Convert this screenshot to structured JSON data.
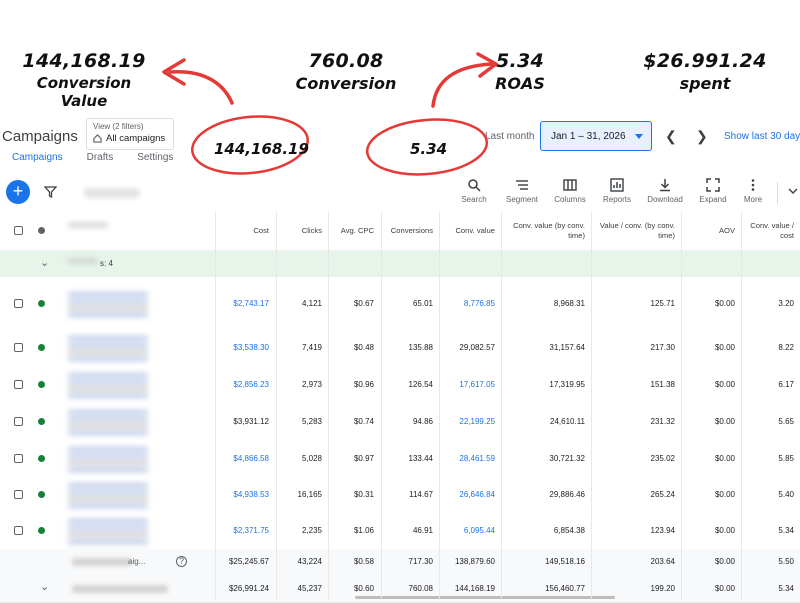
{
  "annotations": {
    "conversion_value": {
      "value": "144,168.19",
      "label": "Conversion Value"
    },
    "conversion": {
      "value": "760.08",
      "label": "Conversion"
    },
    "roas": {
      "value": "5.34",
      "label": "ROAS"
    },
    "spent": {
      "value": "$26.991.24",
      "label": "spent"
    },
    "circled_conv_value": "144,168.19",
    "circled_roas": "5.34",
    "annotation_color": "#e53935"
  },
  "header": {
    "title": "Campaigns",
    "view_label": "View (2 filters)",
    "view_value": "All campaigns",
    "last_month": "Last month",
    "date_range": "Jan 1 – 31, 2026",
    "show_last": "Show last 30 days"
  },
  "tabs": [
    {
      "label": "Campaigns",
      "active": true
    },
    {
      "label": "Drafts",
      "active": false
    },
    {
      "label": "Settings",
      "active": false
    }
  ],
  "toolbar": [
    {
      "label": "Search",
      "icon": "search-icon"
    },
    {
      "label": "Segment",
      "icon": "segment-icon"
    },
    {
      "label": "Columns",
      "icon": "columns-icon"
    },
    {
      "label": "Reports",
      "icon": "reports-icon"
    },
    {
      "label": "Download",
      "icon": "download-icon"
    },
    {
      "label": "Expand",
      "icon": "expand-icon"
    },
    {
      "label": "More",
      "icon": "more-icon"
    }
  ],
  "columns": [
    "Cost",
    "Clicks",
    "Avg. CPC",
    "Conversions",
    "Conv. value",
    "Conv. value (by conv. time)",
    "Value / conv. (by conv. time)",
    "AOV",
    "Conv. value / cost"
  ],
  "group_row": {
    "label": "s: 4"
  },
  "rows": [
    {
      "cost": "$2,743.17",
      "clicks": "4,121",
      "cpc": "$0.67",
      "conv": "65.01",
      "conv_value": "8,776.85",
      "cv_time": "8,968.31",
      "value_conv": "125.71",
      "aov": "$0.00",
      "roas": "3.20",
      "cost_link": true,
      "cv_link": true
    },
    {
      "cost": "$3,538.30",
      "clicks": "7,419",
      "cpc": "$0.48",
      "conv": "135.88",
      "conv_value": "29,082.57",
      "cv_time": "31,157.64",
      "value_conv": "217.30",
      "aov": "$0.00",
      "roas": "8.22",
      "cost_link": true,
      "cv_link": false
    },
    {
      "cost": "$2,856.23",
      "clicks": "2,973",
      "cpc": "$0.96",
      "conv": "126.54",
      "conv_value": "17,617.05",
      "cv_time": "17,319.95",
      "value_conv": "151.38",
      "aov": "$0.00",
      "roas": "6.17",
      "cost_link": true,
      "cv_link": true
    },
    {
      "cost": "$3,931.12",
      "clicks": "5,283",
      "cpc": "$0.74",
      "conv": "94.86",
      "conv_value": "22,199.25",
      "cv_time": "24,610.11",
      "value_conv": "231.32",
      "aov": "$0.00",
      "roas": "5.65",
      "cost_link": false,
      "cv_link": true
    },
    {
      "cost": "$4,866.58",
      "clicks": "5,028",
      "cpc": "$0.97",
      "conv": "133.44",
      "conv_value": "28,461.59",
      "cv_time": "30,721.32",
      "value_conv": "235.02",
      "aov": "$0.00",
      "roas": "5.85",
      "cost_link": true,
      "cv_link": true
    },
    {
      "cost": "$4,938.53",
      "clicks": "16,165",
      "cpc": "$0.31",
      "conv": "114.67",
      "conv_value": "26,646.84",
      "cv_time": "29,886.46",
      "value_conv": "265.24",
      "aov": "$0.00",
      "roas": "5.40",
      "cost_link": true,
      "cv_link": true
    },
    {
      "cost": "$2,371.75",
      "clicks": "2,235",
      "cpc": "$1.06",
      "conv": "46.91",
      "conv_value": "6,095.44",
      "cv_time": "6,854.38",
      "value_conv": "123.94",
      "aov": "$0.00",
      "roas": "5.34",
      "cost_link": true,
      "cv_link": true
    }
  ],
  "total_rows": [
    {
      "label": "aig...",
      "cost": "$25,245.67",
      "clicks": "43,224",
      "cpc": "$0.58",
      "conv": "717.30",
      "conv_value": "138,879.60",
      "cv_time": "149,518.16",
      "value_conv": "203.64",
      "aov": "$0.00",
      "roas": "5.50"
    },
    {
      "label": "",
      "cost": "$26,991.24",
      "clicks": "45,237",
      "cpc": "$0.60",
      "conv": "760.08",
      "conv_value": "144,168.19",
      "cv_time": "156,460.77",
      "value_conv": "199.20",
      "aov": "$0.00",
      "roas": "5.34"
    }
  ],
  "colors": {
    "accent": "#1a73e8",
    "status_green": "#188038",
    "group_bg": "#e6f4ea"
  }
}
